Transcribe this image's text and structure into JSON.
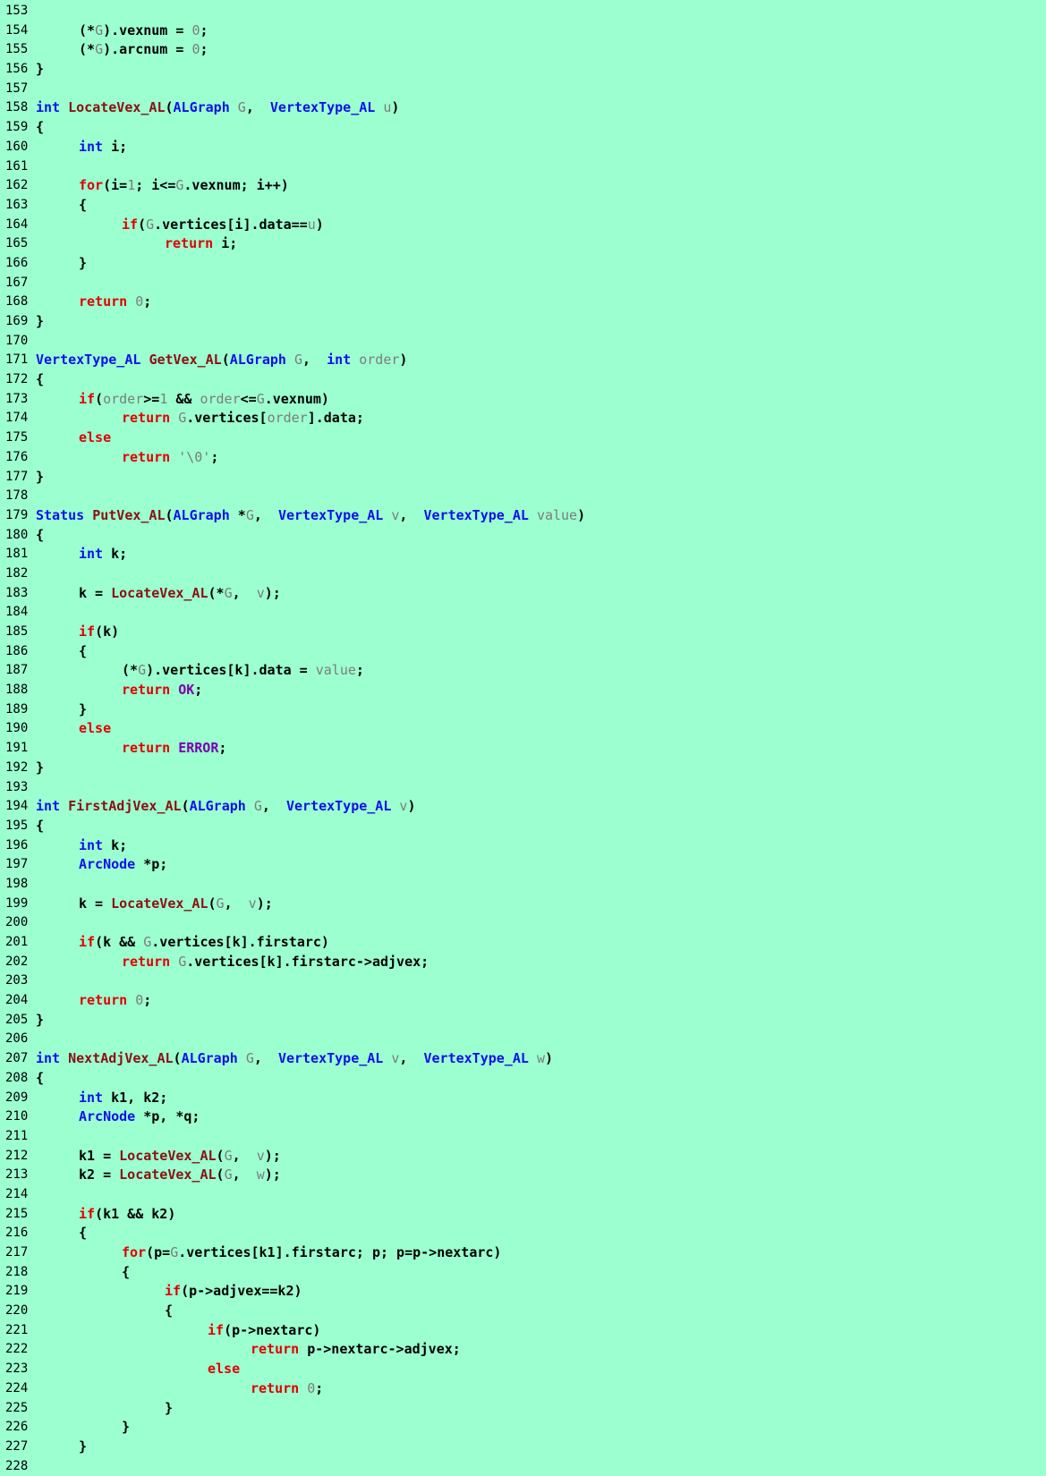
{
  "theme": {
    "background": "#9cffd0",
    "keyword_color": "#e00000",
    "type_color": "#1010e8",
    "function_color": "#8b1010",
    "param_color": "#7c7c7c",
    "constant_color": "#7a00b0",
    "text_color": "#000000"
  },
  "lines": [
    {
      "n": "153",
      "indent": 0,
      "tokens": []
    },
    {
      "n": "154",
      "indent": 1,
      "tokens": [
        [
          "n",
          "("
        ],
        [
          "n",
          "*"
        ],
        [
          "p",
          "G"
        ],
        [
          "n",
          ")."
        ],
        [
          "n",
          "vexnum = "
        ],
        [
          "p",
          "0"
        ],
        [
          "n",
          ";"
        ]
      ]
    },
    {
      "n": "155",
      "indent": 1,
      "tokens": [
        [
          "n",
          "("
        ],
        [
          "n",
          "*"
        ],
        [
          "p",
          "G"
        ],
        [
          "n",
          ")."
        ],
        [
          "n",
          "arcnum = "
        ],
        [
          "p",
          "0"
        ],
        [
          "n",
          ";"
        ]
      ]
    },
    {
      "n": "156",
      "indent": 0,
      "tokens": [
        [
          "n",
          "}"
        ]
      ]
    },
    {
      "n": "157",
      "indent": 0,
      "tokens": []
    },
    {
      "n": "158",
      "indent": 0,
      "tokens": [
        [
          "t",
          "int"
        ],
        [
          "n",
          " "
        ],
        [
          "f",
          "LocateVex_AL"
        ],
        [
          "n",
          "("
        ],
        [
          "t",
          "ALGraph"
        ],
        [
          "n",
          " "
        ],
        [
          "p",
          "G"
        ],
        [
          "n",
          ",  "
        ],
        [
          "t",
          "VertexType_AL"
        ],
        [
          "n",
          " "
        ],
        [
          "p",
          "u"
        ],
        [
          "n",
          ")"
        ]
      ]
    },
    {
      "n": "159",
      "indent": 0,
      "tokens": [
        [
          "n",
          "{"
        ]
      ]
    },
    {
      "n": "160",
      "indent": 1,
      "tokens": [
        [
          "t",
          "int"
        ],
        [
          "n",
          " i;"
        ]
      ]
    },
    {
      "n": "161",
      "indent": 0,
      "tokens": []
    },
    {
      "n": "162",
      "indent": 1,
      "tokens": [
        [
          "k",
          "for"
        ],
        [
          "n",
          "(i="
        ],
        [
          "p",
          "1"
        ],
        [
          "n",
          "; i<="
        ],
        [
          "p",
          "G"
        ],
        [
          "n",
          ".vexnum; i++)"
        ]
      ]
    },
    {
      "n": "163",
      "indent": 1,
      "tokens": [
        [
          "n",
          "{"
        ]
      ]
    },
    {
      "n": "164",
      "indent": 2,
      "tokens": [
        [
          "k",
          "if"
        ],
        [
          "n",
          "("
        ],
        [
          "p",
          "G"
        ],
        [
          "n",
          ".vertices[i].data=="
        ],
        [
          "p",
          "u"
        ],
        [
          "n",
          ")"
        ]
      ]
    },
    {
      "n": "165",
      "indent": 3,
      "tokens": [
        [
          "k",
          "return"
        ],
        [
          "n",
          " i;"
        ]
      ]
    },
    {
      "n": "166",
      "indent": 1,
      "tokens": [
        [
          "n",
          "}"
        ]
      ]
    },
    {
      "n": "167",
      "indent": 0,
      "tokens": []
    },
    {
      "n": "168",
      "indent": 1,
      "tokens": [
        [
          "k",
          "return"
        ],
        [
          "n",
          " "
        ],
        [
          "p",
          "0"
        ],
        [
          "n",
          ";"
        ]
      ]
    },
    {
      "n": "169",
      "indent": 0,
      "tokens": [
        [
          "n",
          "}"
        ]
      ]
    },
    {
      "n": "170",
      "indent": 0,
      "tokens": []
    },
    {
      "n": "171",
      "indent": 0,
      "tokens": [
        [
          "t",
          "VertexType_AL"
        ],
        [
          "n",
          " "
        ],
        [
          "f",
          "GetVex_AL"
        ],
        [
          "n",
          "("
        ],
        [
          "t",
          "ALGraph"
        ],
        [
          "n",
          " "
        ],
        [
          "p",
          "G"
        ],
        [
          "n",
          ",  "
        ],
        [
          "t",
          "int"
        ],
        [
          "n",
          " "
        ],
        [
          "p",
          "order"
        ],
        [
          "n",
          ")"
        ]
      ]
    },
    {
      "n": "172",
      "indent": 0,
      "tokens": [
        [
          "n",
          "{"
        ]
      ]
    },
    {
      "n": "173",
      "indent": 1,
      "tokens": [
        [
          "k",
          "if"
        ],
        [
          "n",
          "("
        ],
        [
          "p",
          "order"
        ],
        [
          "n",
          ">="
        ],
        [
          "p",
          "1"
        ],
        [
          "n",
          " && "
        ],
        [
          "p",
          "order"
        ],
        [
          "n",
          "<="
        ],
        [
          "p",
          "G"
        ],
        [
          "n",
          ".vexnum)"
        ]
      ]
    },
    {
      "n": "174",
      "indent": 2,
      "tokens": [
        [
          "k",
          "return"
        ],
        [
          "n",
          " "
        ],
        [
          "p",
          "G"
        ],
        [
          "n",
          ".vertices["
        ],
        [
          "p",
          "order"
        ],
        [
          "n",
          "].data;"
        ]
      ]
    },
    {
      "n": "175",
      "indent": 1,
      "tokens": [
        [
          "k",
          "else"
        ]
      ]
    },
    {
      "n": "176",
      "indent": 2,
      "tokens": [
        [
          "k",
          "return"
        ],
        [
          "n",
          " "
        ],
        [
          "p",
          "'\\0'"
        ],
        [
          "n",
          ";"
        ]
      ]
    },
    {
      "n": "177",
      "indent": 0,
      "tokens": [
        [
          "n",
          "}"
        ]
      ]
    },
    {
      "n": "178",
      "indent": 0,
      "tokens": []
    },
    {
      "n": "179",
      "indent": 0,
      "tokens": [
        [
          "t",
          "Status"
        ],
        [
          "n",
          " "
        ],
        [
          "f",
          "PutVex_AL"
        ],
        [
          "n",
          "("
        ],
        [
          "t",
          "ALGraph"
        ],
        [
          "n",
          " *"
        ],
        [
          "p",
          "G"
        ],
        [
          "n",
          ",  "
        ],
        [
          "t",
          "VertexType_AL"
        ],
        [
          "n",
          " "
        ],
        [
          "p",
          "v"
        ],
        [
          "n",
          ",  "
        ],
        [
          "t",
          "VertexType_AL"
        ],
        [
          "n",
          " "
        ],
        [
          "p",
          "value"
        ],
        [
          "n",
          ")"
        ]
      ]
    },
    {
      "n": "180",
      "indent": 0,
      "tokens": [
        [
          "n",
          "{"
        ]
      ]
    },
    {
      "n": "181",
      "indent": 1,
      "tokens": [
        [
          "t",
          "int"
        ],
        [
          "n",
          " k;"
        ]
      ]
    },
    {
      "n": "182",
      "indent": 0,
      "tokens": []
    },
    {
      "n": "183",
      "indent": 1,
      "tokens": [
        [
          "n",
          "k = "
        ],
        [
          "f",
          "LocateVex_AL"
        ],
        [
          "n",
          "(*"
        ],
        [
          "p",
          "G"
        ],
        [
          "n",
          ",  "
        ],
        [
          "p",
          "v"
        ],
        [
          "n",
          ");"
        ]
      ]
    },
    {
      "n": "184",
      "indent": 0,
      "tokens": []
    },
    {
      "n": "185",
      "indent": 1,
      "tokens": [
        [
          "k",
          "if"
        ],
        [
          "n",
          "(k)"
        ]
      ]
    },
    {
      "n": "186",
      "indent": 1,
      "tokens": [
        [
          "n",
          "{"
        ]
      ]
    },
    {
      "n": "187",
      "indent": 2,
      "tokens": [
        [
          "n",
          "(*"
        ],
        [
          "p",
          "G"
        ],
        [
          "n",
          ").vertices[k].data = "
        ],
        [
          "p",
          "value"
        ],
        [
          "n",
          ";"
        ]
      ]
    },
    {
      "n": "188",
      "indent": 2,
      "tokens": [
        [
          "k",
          "return"
        ],
        [
          "n",
          " "
        ],
        [
          "c",
          "OK"
        ],
        [
          "n",
          ";"
        ]
      ]
    },
    {
      "n": "189",
      "indent": 1,
      "tokens": [
        [
          "n",
          "}"
        ]
      ]
    },
    {
      "n": "190",
      "indent": 1,
      "tokens": [
        [
          "k",
          "else"
        ]
      ]
    },
    {
      "n": "191",
      "indent": 2,
      "tokens": [
        [
          "k",
          "return"
        ],
        [
          "n",
          " "
        ],
        [
          "c",
          "ERROR"
        ],
        [
          "n",
          ";"
        ]
      ]
    },
    {
      "n": "192",
      "indent": 0,
      "tokens": [
        [
          "n",
          "}"
        ]
      ]
    },
    {
      "n": "193",
      "indent": 0,
      "tokens": []
    },
    {
      "n": "194",
      "indent": 0,
      "tokens": [
        [
          "t",
          "int"
        ],
        [
          "n",
          " "
        ],
        [
          "f",
          "FirstAdjVex_AL"
        ],
        [
          "n",
          "("
        ],
        [
          "t",
          "ALGraph"
        ],
        [
          "n",
          " "
        ],
        [
          "p",
          "G"
        ],
        [
          "n",
          ",  "
        ],
        [
          "t",
          "VertexType_AL"
        ],
        [
          "n",
          " "
        ],
        [
          "p",
          "v"
        ],
        [
          "n",
          ")"
        ]
      ]
    },
    {
      "n": "195",
      "indent": 0,
      "tokens": [
        [
          "n",
          "{"
        ]
      ]
    },
    {
      "n": "196",
      "indent": 1,
      "tokens": [
        [
          "t",
          "int"
        ],
        [
          "n",
          " k;"
        ]
      ]
    },
    {
      "n": "197",
      "indent": 1,
      "tokens": [
        [
          "t",
          "ArcNode"
        ],
        [
          "n",
          " *p;"
        ]
      ]
    },
    {
      "n": "198",
      "indent": 0,
      "tokens": []
    },
    {
      "n": "199",
      "indent": 1,
      "tokens": [
        [
          "n",
          "k = "
        ],
        [
          "f",
          "LocateVex_AL"
        ],
        [
          "n",
          "("
        ],
        [
          "p",
          "G"
        ],
        [
          "n",
          ",  "
        ],
        [
          "p",
          "v"
        ],
        [
          "n",
          ");"
        ]
      ]
    },
    {
      "n": "200",
      "indent": 0,
      "tokens": []
    },
    {
      "n": "201",
      "indent": 1,
      "tokens": [
        [
          "k",
          "if"
        ],
        [
          "n",
          "(k && "
        ],
        [
          "p",
          "G"
        ],
        [
          "n",
          ".vertices[k].firstarc)"
        ]
      ]
    },
    {
      "n": "202",
      "indent": 2,
      "tokens": [
        [
          "k",
          "return"
        ],
        [
          "n",
          " "
        ],
        [
          "p",
          "G"
        ],
        [
          "n",
          ".vertices[k].firstarc->adjvex;"
        ]
      ]
    },
    {
      "n": "203",
      "indent": 0,
      "tokens": []
    },
    {
      "n": "204",
      "indent": 1,
      "tokens": [
        [
          "k",
          "return"
        ],
        [
          "n",
          " "
        ],
        [
          "p",
          "0"
        ],
        [
          "n",
          ";"
        ]
      ]
    },
    {
      "n": "205",
      "indent": 0,
      "tokens": [
        [
          "n",
          "}"
        ]
      ]
    },
    {
      "n": "206",
      "indent": 0,
      "tokens": []
    },
    {
      "n": "207",
      "indent": 0,
      "tokens": [
        [
          "t",
          "int"
        ],
        [
          "n",
          " "
        ],
        [
          "f",
          "NextAdjVex_AL"
        ],
        [
          "n",
          "("
        ],
        [
          "t",
          "ALGraph"
        ],
        [
          "n",
          " "
        ],
        [
          "p",
          "G"
        ],
        [
          "n",
          ",  "
        ],
        [
          "t",
          "VertexType_AL"
        ],
        [
          "n",
          " "
        ],
        [
          "p",
          "v"
        ],
        [
          "n",
          ",  "
        ],
        [
          "t",
          "VertexType_AL"
        ],
        [
          "n",
          " "
        ],
        [
          "p",
          "w"
        ],
        [
          "n",
          ")"
        ]
      ]
    },
    {
      "n": "208",
      "indent": 0,
      "tokens": [
        [
          "n",
          "{"
        ]
      ]
    },
    {
      "n": "209",
      "indent": 1,
      "tokens": [
        [
          "t",
          "int"
        ],
        [
          "n",
          " k1, k2;"
        ]
      ]
    },
    {
      "n": "210",
      "indent": 1,
      "tokens": [
        [
          "t",
          "ArcNode"
        ],
        [
          "n",
          " *p, *q;"
        ]
      ]
    },
    {
      "n": "211",
      "indent": 0,
      "tokens": []
    },
    {
      "n": "212",
      "indent": 1,
      "tokens": [
        [
          "n",
          "k1 = "
        ],
        [
          "f",
          "LocateVex_AL"
        ],
        [
          "n",
          "("
        ],
        [
          "p",
          "G"
        ],
        [
          "n",
          ",  "
        ],
        [
          "p",
          "v"
        ],
        [
          "n",
          ");"
        ]
      ]
    },
    {
      "n": "213",
      "indent": 1,
      "tokens": [
        [
          "n",
          "k2 = "
        ],
        [
          "f",
          "LocateVex_AL"
        ],
        [
          "n",
          "("
        ],
        [
          "p",
          "G"
        ],
        [
          "n",
          ",  "
        ],
        [
          "p",
          "w"
        ],
        [
          "n",
          ");"
        ]
      ]
    },
    {
      "n": "214",
      "indent": 0,
      "tokens": []
    },
    {
      "n": "215",
      "indent": 1,
      "tokens": [
        [
          "k",
          "if"
        ],
        [
          "n",
          "(k1 && k2)"
        ]
      ]
    },
    {
      "n": "216",
      "indent": 1,
      "tokens": [
        [
          "n",
          "{"
        ]
      ]
    },
    {
      "n": "217",
      "indent": 2,
      "tokens": [
        [
          "k",
          "for"
        ],
        [
          "n",
          "(p="
        ],
        [
          "p",
          "G"
        ],
        [
          "n",
          ".vertices[k1].firstarc; p; p=p->nextarc)"
        ]
      ]
    },
    {
      "n": "218",
      "indent": 2,
      "tokens": [
        [
          "n",
          "{"
        ]
      ]
    },
    {
      "n": "219",
      "indent": 3,
      "tokens": [
        [
          "k",
          "if"
        ],
        [
          "n",
          "(p->adjvex==k2)"
        ]
      ]
    },
    {
      "n": "220",
      "indent": 3,
      "tokens": [
        [
          "n",
          "{"
        ]
      ]
    },
    {
      "n": "221",
      "indent": 4,
      "tokens": [
        [
          "k",
          "if"
        ],
        [
          "n",
          "(p->nextarc)"
        ]
      ]
    },
    {
      "n": "222",
      "indent": 5,
      "tokens": [
        [
          "k",
          "return"
        ],
        [
          "n",
          " p->nextarc->adjvex;"
        ]
      ]
    },
    {
      "n": "223",
      "indent": 4,
      "tokens": [
        [
          "k",
          "else"
        ]
      ]
    },
    {
      "n": "224",
      "indent": 5,
      "tokens": [
        [
          "k",
          "return"
        ],
        [
          "n",
          " "
        ],
        [
          "p",
          "0"
        ],
        [
          "n",
          ";"
        ]
      ]
    },
    {
      "n": "225",
      "indent": 3,
      "tokens": [
        [
          "n",
          "}"
        ]
      ]
    },
    {
      "n": "226",
      "indent": 2,
      "tokens": [
        [
          "n",
          "}"
        ]
      ]
    },
    {
      "n": "227",
      "indent": 1,
      "tokens": [
        [
          "n",
          "}"
        ]
      ]
    },
    {
      "n": "228",
      "indent": 0,
      "tokens": []
    }
  ]
}
